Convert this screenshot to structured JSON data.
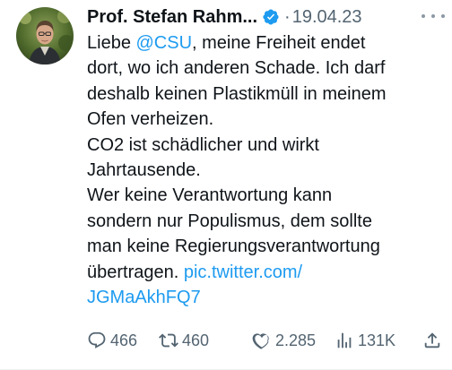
{
  "author": {
    "display_name": "Prof. Stefan Rahm...",
    "verified": true,
    "separator": "·",
    "date": "19.04.23"
  },
  "tweet": {
    "line1_prefix": "Liebe ",
    "mention": "@CSU",
    "line1_suffix": ", meine Freiheit endet",
    "line2": "dort, wo ich anderen Schade. Ich darf",
    "line3": "deshalb keinen Plastikmüll in meinem",
    "line4": "Ofen verheizen.",
    "line5": "CO2 ist schädlicher und wirkt",
    "line6": "Jahrtausende.",
    "line7": "Wer keine Verantwortung kann",
    "line8": "sondern nur Populismus, dem sollte",
    "line9": "man keine Regierungsverantwortung",
    "line10_prefix": "übertragen. ",
    "link_part1": "pic.twitter.com/",
    "link_part2": "JGMaAkhFQ7"
  },
  "actions": {
    "replies": "466",
    "retweets": "460",
    "likes": "2.285",
    "views": "131K"
  },
  "icons": {
    "verified": "verified-badge-icon",
    "more": "more-options-icon",
    "reply": "reply-icon",
    "retweet": "retweet-icon",
    "like": "heart-icon",
    "views": "views-chart-icon",
    "share": "share-icon"
  },
  "colors": {
    "text": "#0f1419",
    "secondary": "#536471",
    "link": "#1d9bf0",
    "verified": "#1d9bf0"
  }
}
